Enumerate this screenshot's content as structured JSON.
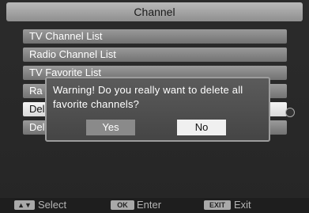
{
  "title": "Channel",
  "menu": [
    {
      "label": "TV Channel List"
    },
    {
      "label": "Radio Channel List"
    },
    {
      "label": "TV Favorite List"
    },
    {
      "label": "Ra"
    },
    {
      "label": "Del"
    },
    {
      "label": "Del"
    }
  ],
  "dialog": {
    "message": "Warning! Do you really want to delete all favorite channels?",
    "yes_label": "Yes",
    "no_label": "No"
  },
  "footer": {
    "select_key": "▲▼",
    "select_label": "Select",
    "enter_key": "OK",
    "enter_label": "Enter",
    "exit_key": "EXIT",
    "exit_label": "Exit"
  }
}
